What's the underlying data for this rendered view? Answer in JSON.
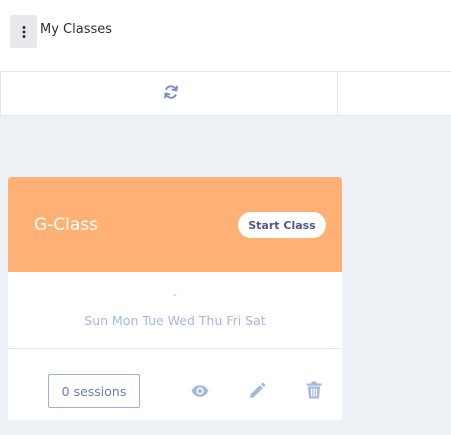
{
  "header": {
    "title": "My Classes",
    "menu_icon": "kebab-menu-icon"
  },
  "toolbar": {
    "refresh_icon": "refresh-icon"
  },
  "class_card": {
    "name": "G-Class",
    "start_label": "Start Class",
    "time": "-",
    "days": "Sun Mon Tue Wed Thu Fri Sat",
    "sessions_label": "0 sessions",
    "actions": [
      "eye-icon",
      "pencil-icon",
      "trash-icon"
    ]
  },
  "colors": {
    "card_header": "#ffb074",
    "accent": "#a4b7dc",
    "background": "#eef2f7"
  }
}
